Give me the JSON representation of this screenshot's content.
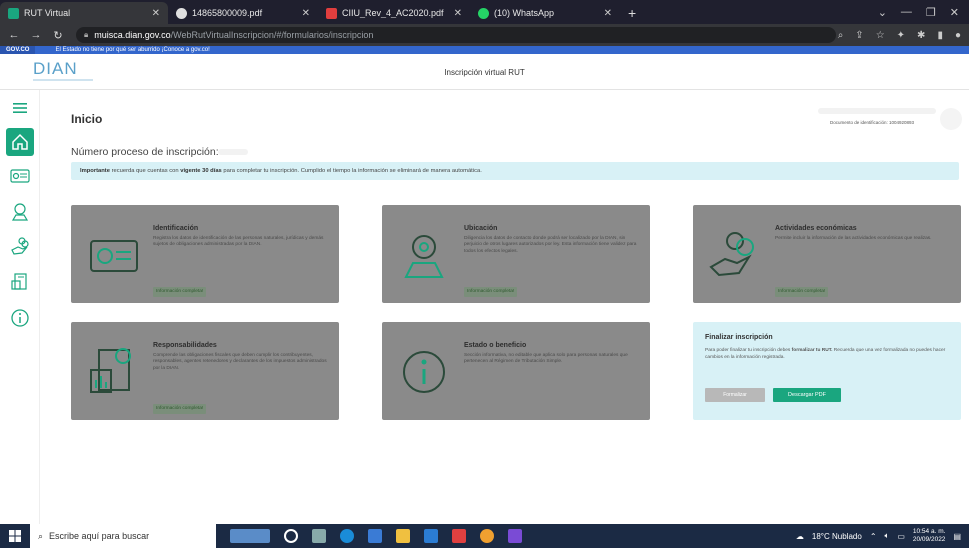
{
  "browser": {
    "tabs": [
      {
        "title": "RUT Virtual",
        "icon": "rut-icon",
        "active": true
      },
      {
        "title": "14865800009.pdf",
        "icon": "globe-icon",
        "active": false
      },
      {
        "title": "CIIU_Rev_4_AC2020.pdf",
        "icon": "pdf-icon",
        "active": false
      },
      {
        "title": "(10) WhatsApp",
        "icon": "whatsapp-icon",
        "active": false
      }
    ],
    "url_domain": "muisca.dian.gov.co",
    "url_path": "/WebRutVirtualInscripcion/#/formularios/inscripcion"
  },
  "gov_banner": {
    "logo": "GOV.CO",
    "text": "El Estado no tiene por qué ser aburrido ¡Conoce a gov.co!"
  },
  "header": {
    "logo": "DIAN",
    "title": "Inscripción virtual RUT"
  },
  "page": {
    "title": "Inicio",
    "user_doc": "Documento de identificación: 1004920893",
    "proceso_label": "Número proceso de inscripción:",
    "alert_strong": "Importante",
    "alert_part1": " recuerda que cuentas con ",
    "alert_days": "vigente 30 días",
    "alert_part2": " para completar tu inscripción. Cumplido el tiempo la información se eliminará de manera automática."
  },
  "cards": [
    {
      "title": "Identificación",
      "desc": "Registra los datos de identificación de las personas naturales, jurídicas y demás sujetos de obligaciones administradas por la DIAN.",
      "status": "Información completa!"
    },
    {
      "title": "Ubicación",
      "desc": "Diligencia los datos de contacto donde podrá ser localizado por la DIAN, sin perjuicio de otros lugares autorizados por ley. Esta información tiene validez para todos los efectos legales.",
      "status": "Información completa!"
    },
    {
      "title": "Actividades económicas",
      "desc": "Permite incluir la información de las actividades económicas que realizas.",
      "status": "Información completa!"
    },
    {
      "title": "Responsabilidades",
      "desc": "Comprende las obligaciones fiscales que deben cumplir los contribuyentes, responsables, agentes retenedores y declarantes de los impuestos administrados por la DIAN.",
      "status": "Información completa!"
    },
    {
      "title": "Estado o beneficio",
      "desc": "Sección informativa, no editable que aplica solo para personas naturales que pertenecen al Régimen de Tributación Simple.",
      "status": ""
    }
  ],
  "finalizar": {
    "title": "Finalizar inscripción",
    "desc_part1": "Para poder finalizar tu inscripción debes ",
    "desc_strong": "formalizar tu RUT.",
    "desc_part2": " Recuerda que una vez formalizada no puedes hacer cambios en la información registrada.",
    "btn_formalizar": "Formalizar",
    "btn_pdf": "Descargar PDF"
  },
  "taskbar": {
    "search_placeholder": "Escribe aquí para buscar",
    "weather": "18°C  Nublado",
    "time": "10:54 a. m.",
    "date": "20/09/2022"
  },
  "colors": {
    "accent_green": "#1aa67f",
    "alert_bg": "#d8f1f6",
    "card_gray": "#8a8a8a",
    "dian_blue": "#5aa0c9",
    "gov_blue": "#3366cc"
  }
}
